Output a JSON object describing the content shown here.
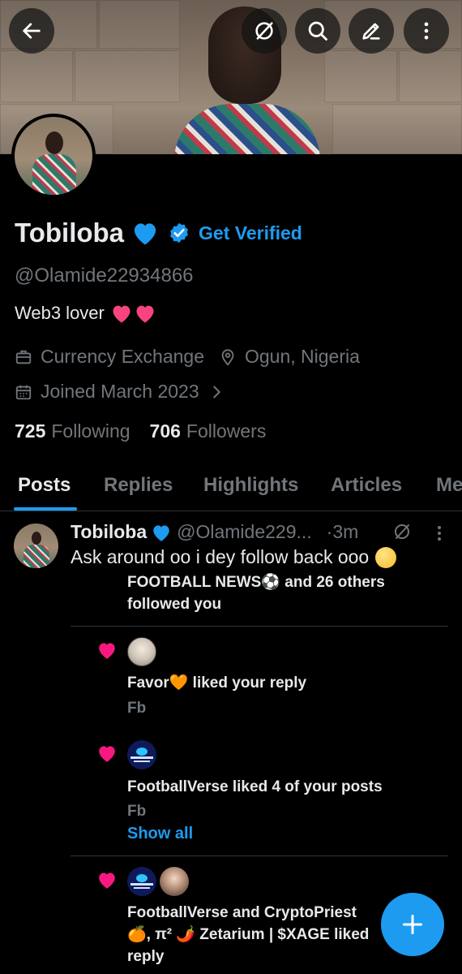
{
  "header": {
    "back_icon": "arrow-left-icon",
    "grok_icon": "grok-icon",
    "search_icon": "search-icon",
    "edit_icon": "pencil-icon",
    "more_icon": "more-vertical-icon"
  },
  "profile": {
    "name": "Tobiloba",
    "get_verified": "Get Verified",
    "handle": "@Olamide22934866",
    "bio": "Web3 lover",
    "profession": "Currency Exchange",
    "location": "Ogun, Nigeria",
    "joined": "Joined March 2023",
    "following_count": "725",
    "following_label": "Following",
    "followers_count": "706",
    "followers_label": "Followers"
  },
  "tabs": [
    {
      "label": "Posts"
    },
    {
      "label": "Replies"
    },
    {
      "label": "Highlights"
    },
    {
      "label": "Articles"
    },
    {
      "label": "Me"
    }
  ],
  "post": {
    "name": "Tobiloba",
    "handle": "@Olamide229...",
    "time": "·3m",
    "text": "Ask around oo i dey follow back ooo",
    "followed_line1": "FOOTBALL NEWS⚽ and 26 others",
    "followed_line2": "followed you"
  },
  "notifications": [
    {
      "text": "Favor🧡 liked your reply",
      "sub": "Fb"
    },
    {
      "text": "FootballVerse liked 4 of your posts",
      "sub": "Fb",
      "show_all": "Show all"
    },
    {
      "line1": "FootballVerse and CryptoPriest",
      "line2": "🍊, π² 🌶️ Zetarium | $XAGE liked",
      "line3": "reply"
    }
  ],
  "colors": {
    "accent": "#1d9bf0",
    "background": "#000000",
    "muted": "#71767b",
    "like_pink": "#f91880",
    "heart_blue": "#1d9bf0"
  },
  "fab": {
    "icon": "plus-icon"
  }
}
